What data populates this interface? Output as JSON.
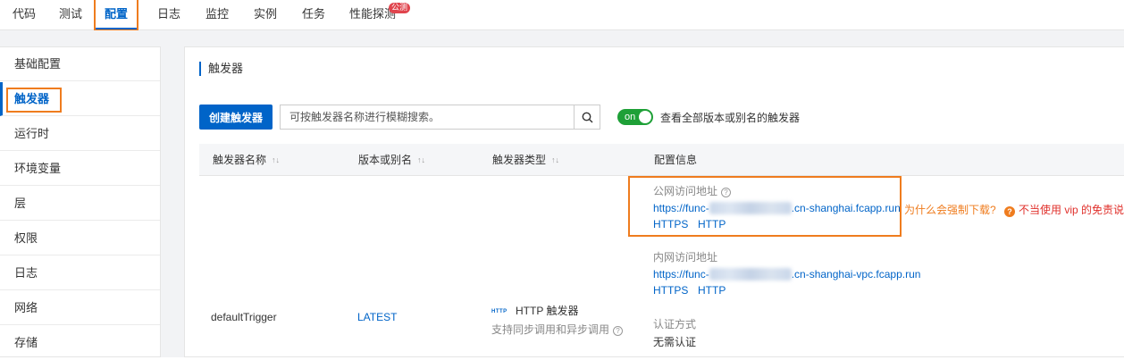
{
  "top_tabs": [
    "代码",
    "测试",
    "配置",
    "日志",
    "监控",
    "实例",
    "任务",
    "性能探测"
  ],
  "top_tab_badge": "公测",
  "sidebar": [
    "基础配置",
    "触发器",
    "运行时",
    "环境变量",
    "层",
    "权限",
    "日志",
    "网络",
    "存储"
  ],
  "section_title": "触发器",
  "toolbar": {
    "create_label": "创建触发器",
    "search_placeholder": "可按触发器名称进行模糊搜索。",
    "switch_label": "on",
    "switch_text": "查看全部版本或别名的触发器"
  },
  "table": {
    "headers": [
      "触发器名称",
      "版本或别名",
      "触发器类型",
      "配置信息"
    ],
    "row": {
      "name": "defaultTrigger",
      "version": "LATEST",
      "type_tag": "HTTP",
      "type": "HTTP 触发器",
      "type_desc": "支持同步调用和异步调用",
      "public_label": "公网访问地址",
      "public_url_prefix": "https://func-",
      "public_url_suffix": ".cn-shanghai.fcapp.run",
      "public_https": "HTTPS",
      "public_http": "HTTP",
      "internal_label": "内网访问地址",
      "internal_url_prefix": "https://func-",
      "internal_url_suffix": ".cn-shanghai-vpc.fcapp.run",
      "internal_https": "HTTPS",
      "internal_http": "HTTP",
      "auth_label": "认证方式",
      "auth_value": "无需认证"
    }
  },
  "notes": {
    "why_download": "为什么会强制下载?",
    "vip_warning": "不当使用 vip 的免责说明"
  }
}
